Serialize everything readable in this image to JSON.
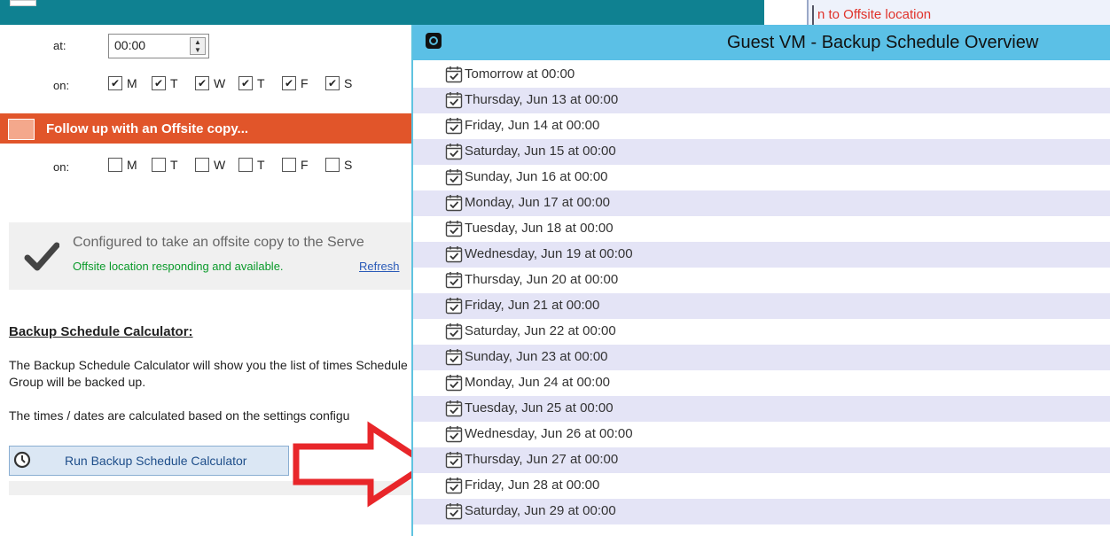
{
  "background_window": {
    "right_strip_text": "n to Offsite location",
    "schedule": {
      "at_label": "at:",
      "time_value": "00:00",
      "on_label": "on:",
      "days": [
        {
          "label": "M",
          "checked": true
        },
        {
          "label": "T",
          "checked": true
        },
        {
          "label": "W",
          "checked": true
        },
        {
          "label": "T",
          "checked": true
        },
        {
          "label": "F",
          "checked": true
        },
        {
          "label": "S",
          "checked": true
        }
      ]
    },
    "offsite": {
      "header": "Follow up with an Offsite copy...",
      "on_label": "on:",
      "days": [
        {
          "label": "M",
          "checked": false
        },
        {
          "label": "T",
          "checked": false
        },
        {
          "label": "W",
          "checked": false
        },
        {
          "label": "T",
          "checked": false
        },
        {
          "label": "F",
          "checked": false
        },
        {
          "label": "S",
          "checked": false
        }
      ]
    },
    "status": {
      "line1": "Configured to take an offsite copy to the Serve",
      "line2": "Offsite location responding and available.",
      "refresh": "Refresh"
    },
    "calculator": {
      "title": "Backup Schedule Calculator:",
      "paragraph1": "The Backup Schedule Calculator will show you the list of times Schedule Group will be backed up.",
      "paragraph2": "The times / dates are calculated based on the settings configu",
      "run_button": "Run Backup Schedule Calculator"
    }
  },
  "popup": {
    "title": "Guest VM - Backup Schedule Overview",
    "items": [
      "Tomorrow at 00:00",
      "Thursday, Jun 13 at 00:00",
      "Friday, Jun 14 at 00:00",
      "Saturday, Jun 15 at 00:00",
      "Sunday, Jun 16 at 00:00",
      "Monday, Jun 17 at 00:00",
      "Tuesday, Jun 18 at 00:00",
      "Wednesday, Jun 19 at 00:00",
      "Thursday, Jun 20 at 00:00",
      "Friday, Jun 21 at 00:00",
      "Saturday, Jun 22 at 00:00",
      "Sunday, Jun 23 at 00:00",
      "Monday, Jun 24 at 00:00",
      "Tuesday, Jun 25 at 00:00",
      "Wednesday, Jun 26 at 00:00",
      "Thursday, Jun 27 at 00:00",
      "Friday, Jun 28 at 00:00",
      "Saturday, Jun 29 at 00:00"
    ]
  },
  "colors": {
    "teal_header": "#0f8191",
    "offsite_orange": "#e1552a",
    "popup_titlebar": "#5bc0e6",
    "row_alt": "#e4e4f6",
    "arrow_red": "#e8262a"
  }
}
